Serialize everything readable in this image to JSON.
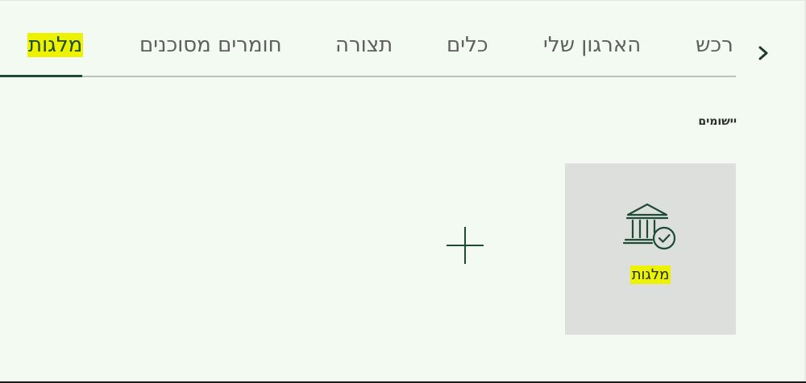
{
  "tabs": [
    {
      "label": "מלגות",
      "active": true
    },
    {
      "label": "חומרים מסוכנים",
      "active": false
    },
    {
      "label": "תצורה",
      "active": false
    },
    {
      "label": "כלים",
      "active": false
    },
    {
      "label": "הארגון שלי",
      "active": false
    },
    {
      "label": "רכש",
      "active": false
    }
  ],
  "tab_scroll": {
    "icon": "chevron-right-icon"
  },
  "section": {
    "title": "יישומים"
  },
  "apps": [
    {
      "label": "מלגות",
      "icon": "bank-check-icon"
    }
  ],
  "add_tile": {
    "icon": "plus-icon"
  },
  "colors": {
    "background": "#f3faf1",
    "accent": "#1e4a37",
    "highlight": "#ecf200",
    "tile": "#dcdfdb"
  }
}
